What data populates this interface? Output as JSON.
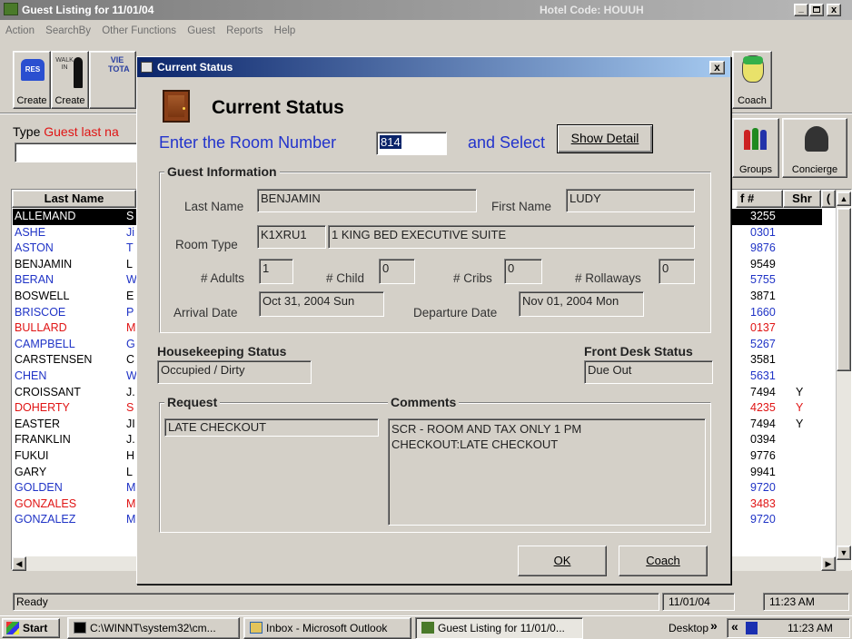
{
  "main_window": {
    "title": "Guest Listing for 11/01/04",
    "hotel_code": "Hotel Code: HOUUH",
    "menu": [
      "Action",
      "SearchBy",
      "Other Functions",
      "Guest",
      "Reports",
      "Help"
    ],
    "toolbar": {
      "res_label": "Create",
      "walkin_label": "Create",
      "view_text": "VIE TOTA",
      "coach_label": "Coach",
      "groups_label": "Groups",
      "concierge_label": "Concierge"
    },
    "search": {
      "type_prefix": "Type",
      "type_hint": "Guest last na",
      "value": ""
    },
    "grid": {
      "headers": {
        "last_name": "Last Name",
        "conf": "f #",
        "shr": "Shr",
        "extra": "("
      },
      "rows": [
        {
          "last": "ALLEMAND",
          "first": "S",
          "conf": "3255",
          "shr": "",
          "color": "selected"
        },
        {
          "last": "ASHE",
          "first": "Ji",
          "conf": "0301",
          "shr": "",
          "color": "blue"
        },
        {
          "last": "ASTON",
          "first": "T",
          "conf": "9876",
          "shr": "",
          "color": "blue"
        },
        {
          "last": "BENJAMIN",
          "first": "L",
          "conf": "9549",
          "shr": "",
          "color": "black"
        },
        {
          "last": "BERAN",
          "first": "W",
          "conf": "5755",
          "shr": "",
          "color": "blue"
        },
        {
          "last": "BOSWELL",
          "first": "E",
          "conf": "3871",
          "shr": "",
          "color": "black"
        },
        {
          "last": "BRISCOE",
          "first": "P",
          "conf": "1660",
          "shr": "",
          "color": "blue"
        },
        {
          "last": "BULLARD",
          "first": "M",
          "conf": "0137",
          "shr": "",
          "color": "red"
        },
        {
          "last": "CAMPBELL",
          "first": "G",
          "conf": "5267",
          "shr": "",
          "color": "blue"
        },
        {
          "last": "CARSTENSEN",
          "first": "C",
          "conf": "3581",
          "shr": "",
          "color": "black"
        },
        {
          "last": "CHEN",
          "first": "W",
          "conf": "5631",
          "shr": "",
          "color": "blue"
        },
        {
          "last": "CROISSANT",
          "first": "J.",
          "conf": "7494",
          "shr": "Y",
          "color": "black"
        },
        {
          "last": "DOHERTY",
          "first": "S",
          "conf": "4235",
          "shr": "Y",
          "color": "red"
        },
        {
          "last": "EASTER",
          "first": "JI",
          "conf": "7494",
          "shr": "Y",
          "color": "black"
        },
        {
          "last": "FRANKLIN",
          "first": "J.",
          "conf": "0394",
          "shr": "",
          "color": "black"
        },
        {
          "last": "FUKUI",
          "first": "H",
          "conf": "9776",
          "shr": "",
          "color": "black"
        },
        {
          "last": "GARY",
          "first": "L",
          "conf": "9941",
          "shr": "",
          "color": "black"
        },
        {
          "last": "GOLDEN",
          "first": "M",
          "conf": "9720",
          "shr": "",
          "color": "blue"
        },
        {
          "last": "GONZALES",
          "first": "M",
          "conf": "3483",
          "shr": "",
          "color": "red"
        },
        {
          "last": "GONZALEZ",
          "first": "M",
          "conf": "9720",
          "shr": "",
          "color": "blue"
        }
      ]
    },
    "status_bar": {
      "text": "Ready",
      "date": "11/01/04",
      "time": "11:23 AM"
    }
  },
  "dialog": {
    "title": "Current Status",
    "heading": "Current Status",
    "room_prompt": "Enter the Room Number",
    "room_number": "814",
    "and_select": "and Select",
    "show_detail": "Show Detail",
    "guest_info": {
      "group_title": "Guest Information",
      "last_name_label": "Last Name",
      "last_name": "BENJAMIN",
      "first_name_label": "First Name",
      "first_name": "LUDY",
      "room_type_label": "Room Type",
      "room_type_code": "K1XRU1",
      "room_type_desc": "1 KING BED EXECUTIVE SUITE",
      "adults_label": "# Adults",
      "adults": "1",
      "child_label": "# Child",
      "child": "0",
      "cribs_label": "# Cribs",
      "cribs": "0",
      "rollaways_label": "# Rollaways",
      "rollaways": "0",
      "arrival_label": "Arrival Date",
      "arrival": "Oct 31, 2004 Sun",
      "departure_label": "Departure Date",
      "departure": "Nov 01, 2004 Mon"
    },
    "housekeeping_label": "Housekeeping Status",
    "housekeeping": "Occupied / Dirty",
    "frontdesk_label": "Front Desk Status",
    "frontdesk": "Due Out",
    "request_label": "Request",
    "request": "LATE CHECKOUT",
    "comments_label": "Comments",
    "comments_line1": "SCR - ROOM AND TAX ONLY 1 PM",
    "comments_line2": "CHECKOUT:LATE CHECKOUT",
    "ok_label": "OK",
    "coach_label": "Coach"
  },
  "taskbar": {
    "start": "Start",
    "items": [
      "C:\\WINNT\\system32\\cm...",
      "Inbox - Microsoft Outlook",
      "Guest Listing for 11/01/0..."
    ],
    "desktop": "Desktop",
    "chevrons": "»",
    "back": "«",
    "clock": "11:23 AM"
  },
  "colors": {
    "blue_text": "#1f33c6",
    "red_text": "#e01414",
    "dialog_title": "#0a246a",
    "selected_row": "#000000"
  }
}
